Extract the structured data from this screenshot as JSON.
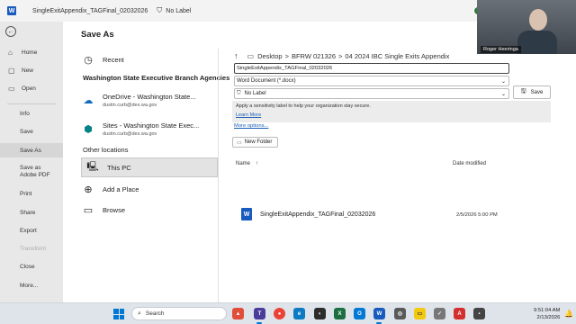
{
  "titlebar": {
    "app_icon": "W",
    "filename": "SingleExitAppendix_TAGFinal_02032026",
    "label_icon": "shield-icon",
    "label_text": "No Label"
  },
  "leftnav": {
    "back_icon": "back-arrow-icon",
    "items": [
      {
        "label": "Home",
        "icon": "⌂"
      },
      {
        "label": "New",
        "icon": "▢"
      },
      {
        "label": "Open",
        "icon": "▭"
      },
      {
        "label": "Info"
      },
      {
        "label": "Save"
      },
      {
        "label": "Save As"
      },
      {
        "label": "Save as Adobe PDF"
      },
      {
        "label": "Print"
      },
      {
        "label": "Share"
      },
      {
        "label": "Export"
      },
      {
        "label": "Transform"
      },
      {
        "label": "Close"
      },
      {
        "label": "More..."
      }
    ]
  },
  "saveas": {
    "title": "Save As",
    "recent": "Recent",
    "org_heading": "Washington State Executive Branch Agencies",
    "onedrive": {
      "name": "OneDrive - Washington State...",
      "email": "dustin.curb@des.wa.gov"
    },
    "sites": {
      "name": "Sites - Washington State Exec...",
      "email": "dustin.curb@des.wa.gov"
    },
    "other_heading": "Other locations",
    "this_pc": "This PC",
    "add_place": "Add a Place",
    "browse": "Browse"
  },
  "right": {
    "breadcrumb": {
      "p1": "Desktop",
      "sep": ">",
      "p2": "BFRW 021326",
      "p3": "04 2024 IBC Single Exits Appendix"
    },
    "filename_value": "SingleExitAppendix_TAGFinal_02032026",
    "file_type": "Word Document (*.docx)",
    "sensitivity_label": "No Label",
    "save_label": "Save",
    "info_text": "Apply a sensitivity label to help your organization stay secure.",
    "learn_more": "Learn More",
    "more_options": "More options...",
    "new_folder": "New Folder",
    "col_name": "Name",
    "col_date": "Date modified",
    "files": [
      {
        "name": "SingleExitAppendix_TAGFinal_02032026",
        "date": "2/5/2026 5:00 PM"
      }
    ]
  },
  "webcam": {
    "name": "Roger Heeringa"
  },
  "taskbar": {
    "search": "Search",
    "time": "9:51:04 AM",
    "date": "2/13/2026"
  },
  "colors": {
    "accent": "#185abd",
    "link": "#1a5fb4",
    "nav_bg": "#e8e8e8"
  }
}
